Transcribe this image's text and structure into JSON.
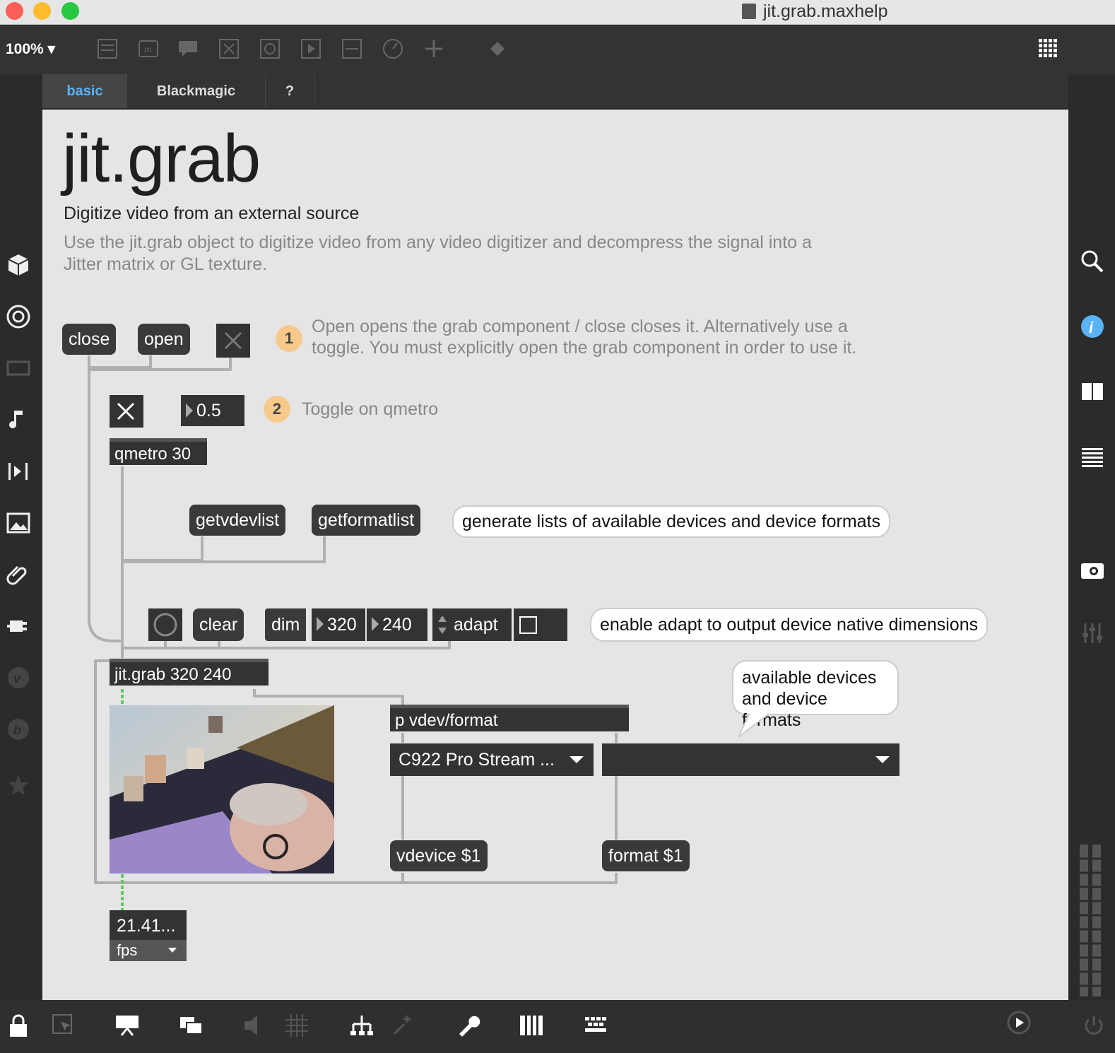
{
  "window": {
    "title": "jit.grab.maxhelp"
  },
  "toolbar": {
    "zoom": "100%"
  },
  "tabs": [
    "basic",
    "Blackmagic",
    "?"
  ],
  "patch": {
    "title": "jit.grab",
    "subtitle": "Digitize video from an external source",
    "description": "Use the jit.grab object to digitize video from any video digitizer and decompress the signal into a Jitter matrix or GL texture.",
    "step1": {
      "badge": "1",
      "text": "Open opens the grab component / close closes it. Alternatively use a toggle. You must explicitly open the grab component in order to use it."
    },
    "step2": {
      "badge": "2",
      "text": "Toggle on qmetro"
    },
    "messages": {
      "close": "close",
      "open": "open",
      "getvdevlist": "getvdevlist",
      "getformatlist": "getformatlist",
      "clear": "clear",
      "dim": "dim",
      "adapt": "adapt",
      "vdevice": "vdevice $1",
      "format": "format $1"
    },
    "numbers": {
      "interval": "0.5",
      "dim_w": "320",
      "dim_h": "240",
      "fps_value": "21.41..."
    },
    "objects": {
      "qmetro": "qmetro 30",
      "jitgrab": "jit.grab 320 240",
      "pvdev": "p vdev/format"
    },
    "bubbles": {
      "lists": "generate lists of available devices and device formats",
      "adapt": "enable adapt to output device native dimensions",
      "available_line1": "available devices",
      "available_line2": "and device formats"
    },
    "menus": {
      "device": "C922 Pro Stream ...",
      "format": "",
      "fps_unit": "fps"
    },
    "colors": {
      "accent": "#5ab3f5",
      "badge": "#f7c98b",
      "canvas": "#e5e5e5"
    }
  }
}
